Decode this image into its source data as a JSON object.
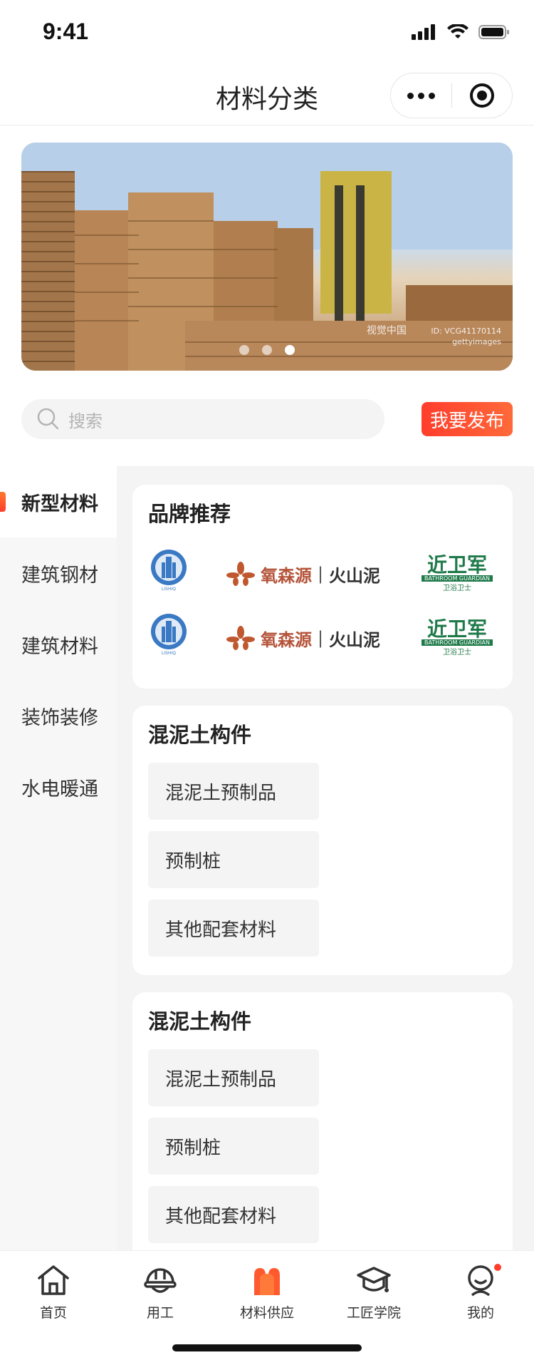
{
  "status": {
    "time": "9:41"
  },
  "nav": {
    "title": "材料分类"
  },
  "banner": {
    "watermark_1": "视觉中国",
    "watermark_2": "ID: VCG41170114",
    "watermark_3": "gettyimages"
  },
  "search": {
    "placeholder": "搜索"
  },
  "publish": {
    "label": "我要发布"
  },
  "sidebar": {
    "items": [
      {
        "label": "新型材料"
      },
      {
        "label": "建筑钢材"
      },
      {
        "label": "建筑材料"
      },
      {
        "label": "装饰装修"
      },
      {
        "label": "水电暖通"
      }
    ]
  },
  "brands": {
    "title": "品牌推荐",
    "logo_b_text_1": "氧森源",
    "logo_b_text_2": "火山泥",
    "logo_c_text_1": "近卫军",
    "logo_c_text_2": "BATHROOM GUARDIAN",
    "logo_c_text_3": "卫浴卫士",
    "logo_a_text": "LISHIQ"
  },
  "sections": [
    {
      "title": "混泥土构件",
      "chips": [
        "混泥土预制品",
        "预制桩",
        "其他配套材料"
      ]
    },
    {
      "title": "混泥土构件",
      "chips": [
        "混泥土预制品",
        "预制桩",
        "其他配套材料"
      ]
    }
  ],
  "tabs": [
    {
      "label": "首页"
    },
    {
      "label": "用工"
    },
    {
      "label": "材料供应"
    },
    {
      "label": "工匠学院"
    },
    {
      "label": "我的"
    }
  ],
  "colors": {
    "accent": "#ff3d2c",
    "accent2": "#ff6a3a"
  }
}
